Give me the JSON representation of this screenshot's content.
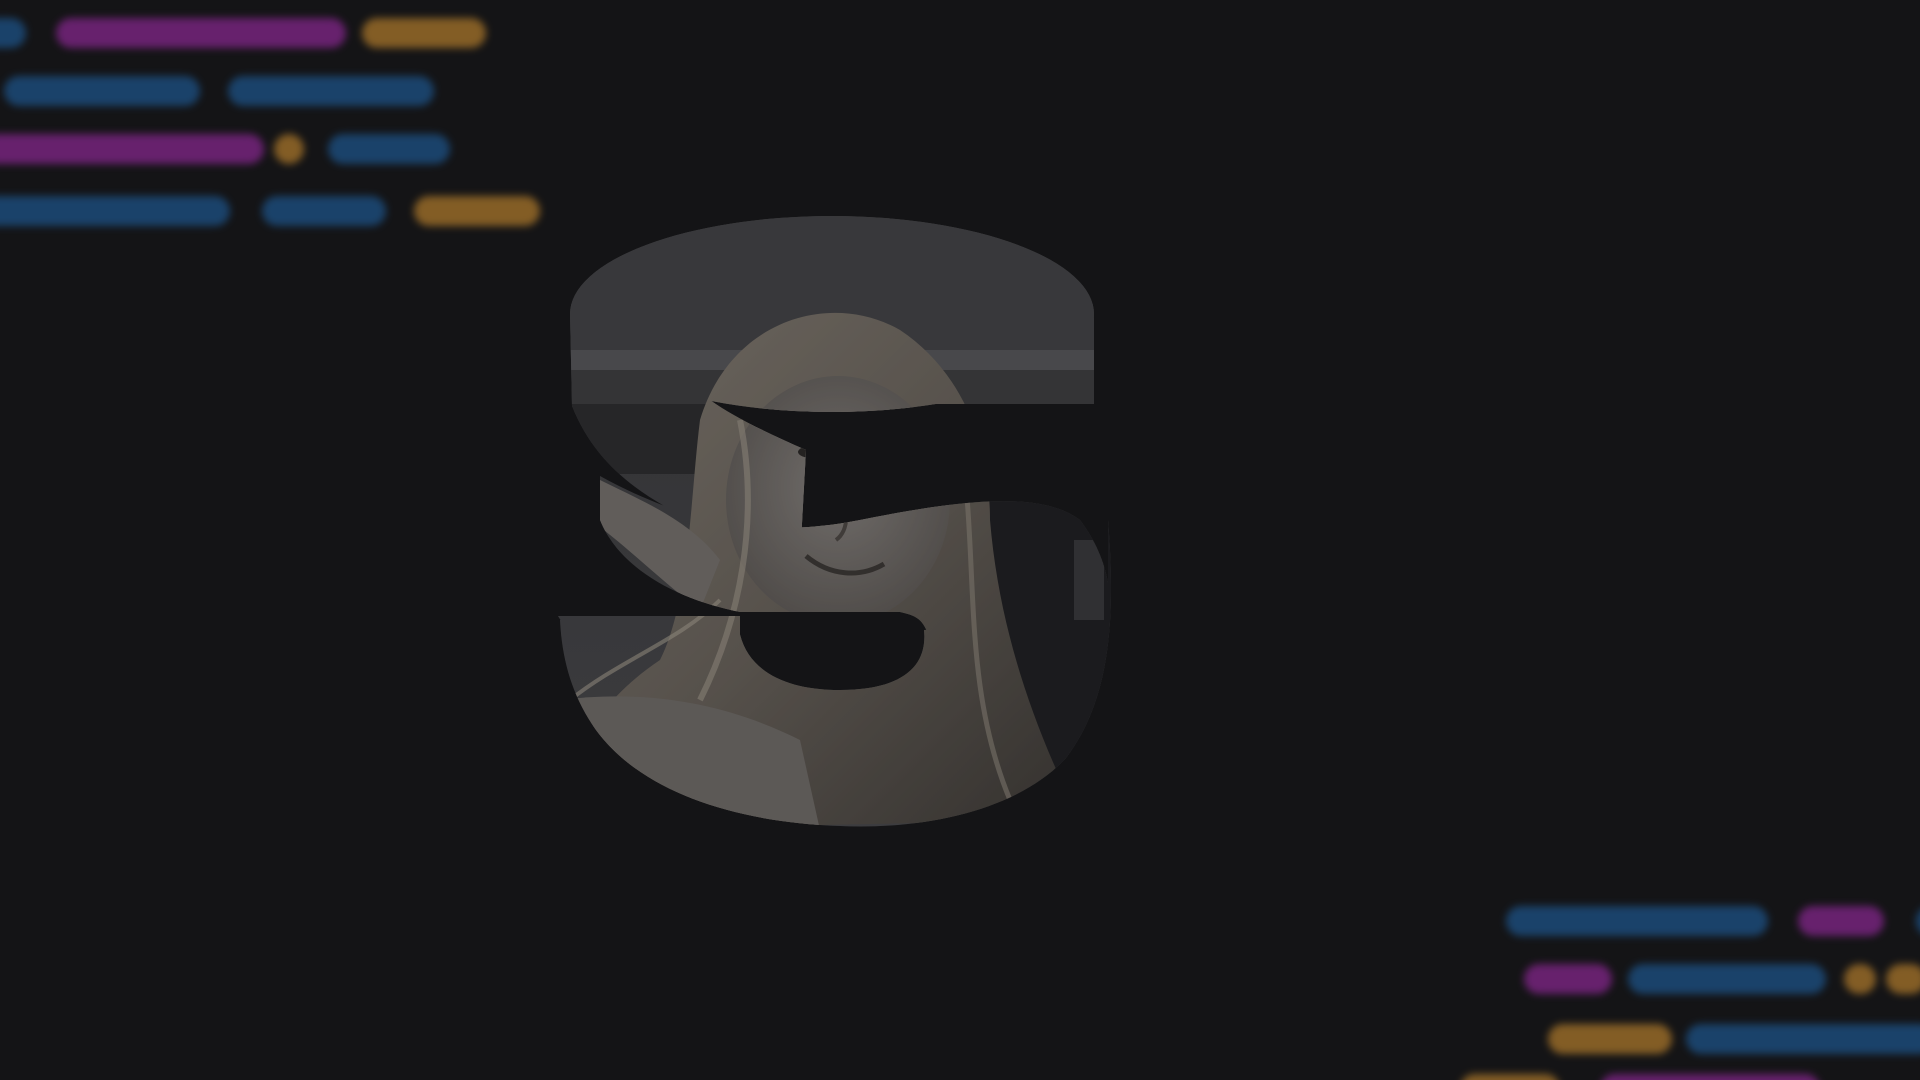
{
  "scene": {
    "background_color": "#141416",
    "monogram_letter": "S",
    "photo_description_tone": "grayscale",
    "palette": {
      "blue": "#1f5f9e",
      "purple": "#9a2aa3",
      "orange": "#c78a2f"
    }
  },
  "code_snippets": {
    "top_left": [
      [
        "blue",
        "purple",
        "orange"
      ],
      [
        "blue",
        "blue"
      ],
      [
        "purple",
        "orange",
        "blue"
      ],
      [
        "blue",
        "blue",
        "orange"
      ]
    ],
    "bottom_right": [
      [
        "blue",
        "purple",
        "blue"
      ],
      [
        "purple",
        "blue",
        "orange",
        "orange"
      ],
      [
        "orange",
        "blue"
      ],
      [
        "orange",
        "purple"
      ]
    ]
  }
}
